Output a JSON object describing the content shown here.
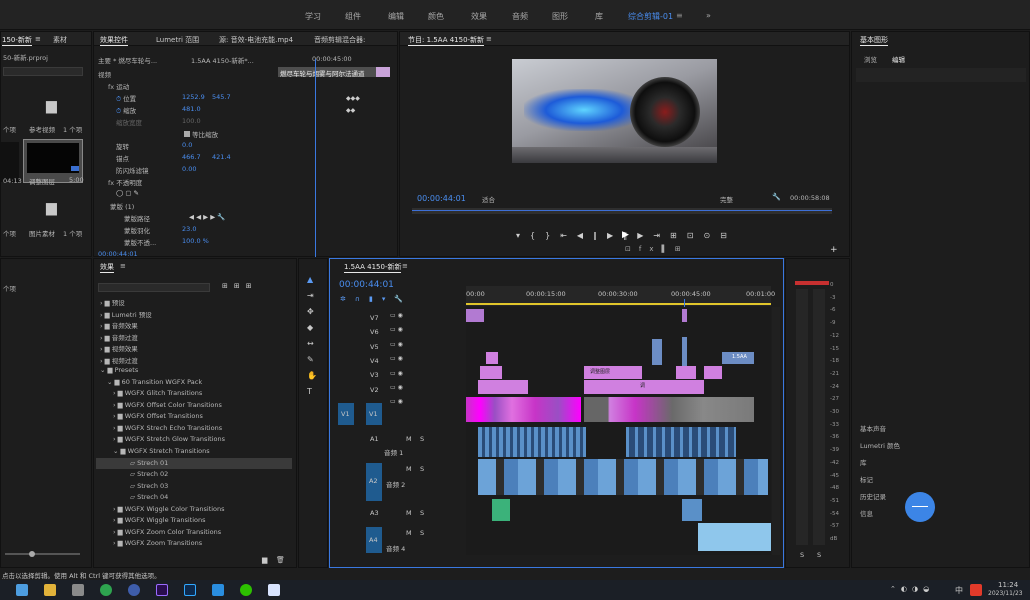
{
  "workspaces": [
    "学习",
    "组件",
    "编辑",
    "颜色",
    "效果",
    "音频",
    "图形",
    "库",
    "综合剪辑-01"
  ],
  "menu_more": "»",
  "project": {
    "tab1": "150-新新",
    "tab_more": "≡",
    "tab2": "素材",
    "file": "50-新新.prproj",
    "items": [
      {
        "label": "个项",
        "name": "参考视频",
        "count": "1 个项"
      },
      {
        "label": "04:13",
        "name": "调整图层",
        "count": "5:00"
      },
      {
        "label": "个项",
        "name": "图片素材",
        "count": "1 个项"
      },
      {
        "label": "个项",
        "name": "",
        "count": ""
      }
    ]
  },
  "effect_controls": {
    "tabs": [
      "效果控件",
      "Lumetri 范围",
      "源: 音效-电池充能.mp4",
      "音频剪辑混合器:"
    ],
    "master": "主要 * 燃尽车轮与...",
    "seq": "1.5AA 4150-新新*...",
    "time_label": "00:00:45:00",
    "clip_label": "燃尽车轮与烟雾与阿尔法通道",
    "section_video": "视频",
    "motion": "运动",
    "position": {
      "label": "位置",
      "x": "1252.9",
      "y": "545.7"
    },
    "scale": {
      "label": "缩放",
      "value": "481.0"
    },
    "scale_width": {
      "label": "缩放宽度",
      "value": "100.0"
    },
    "uniform": "等比缩放",
    "rotation": {
      "label": "旋转",
      "value": "0.0"
    },
    "anchor": {
      "label": "锚点",
      "x": "466.7",
      "y": "421.4"
    },
    "flicker": {
      "label": "防闪烁滤镜",
      "value": "0.00"
    },
    "opacity": "不透明度",
    "mask": "蒙版 (1)",
    "mask_path": "蒙版路径",
    "mask_feather": {
      "label": "蒙版羽化",
      "value": "23.0"
    },
    "mask_opacity": {
      "label": "蒙版不透...",
      "value": "100.0 %"
    },
    "timecode": "00:00:44:01"
  },
  "program": {
    "title": "节目: 1.5AA 4150-新新",
    "tab_more": "≡",
    "timecode": "00:00:44:01",
    "fit": "适合",
    "quality": "完整",
    "duration": "00:00:58:08"
  },
  "essential_graphics": {
    "title": "基本图形",
    "tab_browse": "浏览",
    "tab_edit": "编辑",
    "panels": [
      "基本声音",
      "Lumetri 颜色",
      "库",
      "标记",
      "历史记录",
      "信息"
    ]
  },
  "effects": {
    "title": "效果",
    "tab_more": "≡",
    "search_placeholder": "",
    "folders": [
      "预设",
      "Lumetri 预设",
      "音频效果",
      "音频过渡",
      "视频效果",
      "视频过渡",
      "Presets",
      "60 Transition WGFX Pack",
      "WGFX Glitch Transitions",
      "WGFX Offset Color Transitions",
      "WGFX Offset Transitions",
      "WGFX Strech Echo Transitions",
      "WGFX Stretch Glow Transitions",
      "WGFX Stretch Transitions",
      "Strech 01",
      "Strech 02",
      "Strech 03",
      "Strech 04",
      "WGFX Wiggle Color Transitions",
      "WGFX Wiggle Transitions",
      "WGFX Zoom Color Transitions",
      "WGFX Zoom Transitions"
    ]
  },
  "timeline": {
    "title": "1.5AA 4150-新新",
    "tab_more": "≡",
    "timecode": "00:00:44:01",
    "ruler": [
      "00:00",
      "00:00:15:00",
      "00:00:30:00",
      "00:00:45:00",
      "00:01:00"
    ],
    "video_tracks": [
      "V7",
      "V6",
      "V5",
      "V4",
      "V3",
      "V2",
      "V1"
    ],
    "v1_src": "V1",
    "audio_tracks": [
      {
        "id": "A1",
        "name": "音频 1"
      },
      {
        "id": "A2",
        "name": "音频 2"
      },
      {
        "id": "A3",
        "name": ""
      },
      {
        "id": "A4",
        "name": "音频 4"
      }
    ],
    "m": "M",
    "s": "S",
    "clip_labels": [
      "调整图层",
      "调",
      "1.5AA"
    ]
  },
  "meter": {
    "ticks": [
      "0",
      "-3",
      "-6",
      "-9",
      "-12",
      "-15",
      "-18",
      "-21",
      "-24",
      "-27",
      "-30",
      "-33",
      "-36",
      "-39",
      "-42",
      "-45",
      "-48",
      "-51",
      "-54",
      "-57",
      "dB"
    ],
    "solo": "S"
  },
  "statusbar": "点击以选择剪辑。使用 Alt 和 Ctrl 键可获得其他选项。",
  "taskbar": {
    "time": "11:24",
    "date": "2023/11/23",
    "ime": "中"
  }
}
